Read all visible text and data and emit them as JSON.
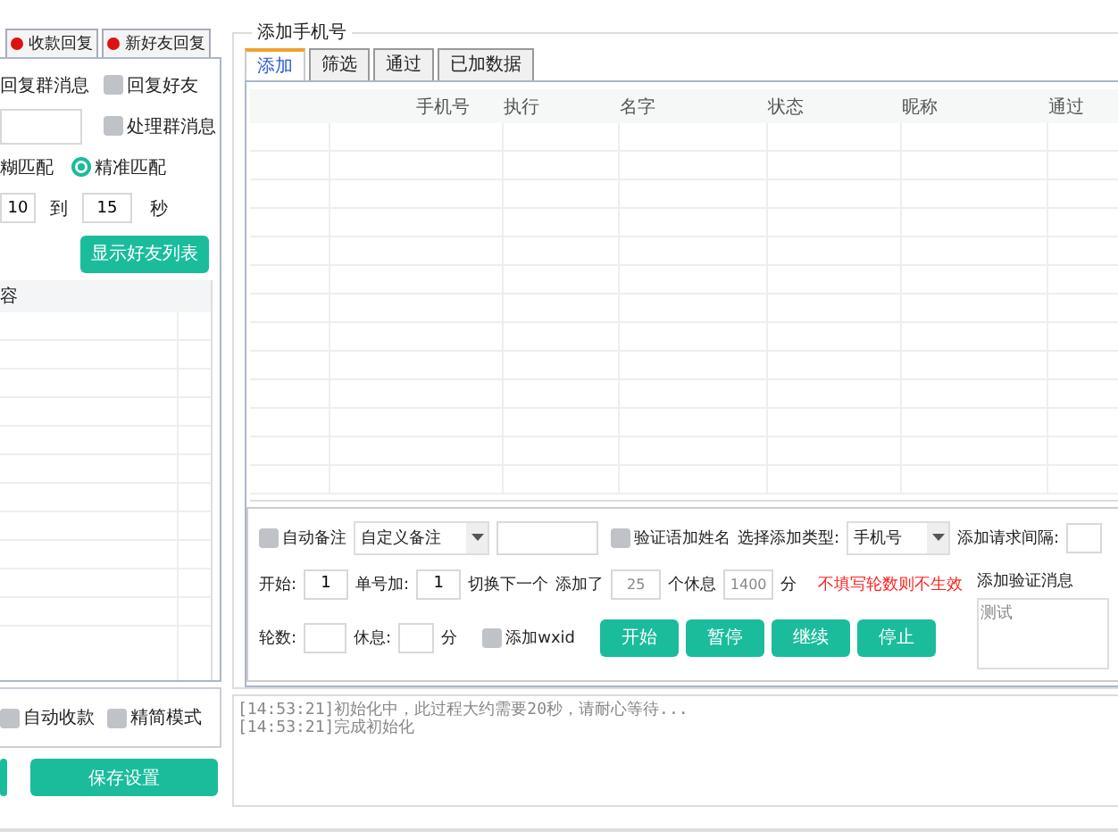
{
  "left_panel": {
    "tabs": [
      {
        "label": "收款回复",
        "color": "#dd1111"
      },
      {
        "label": "新好友回复",
        "color": "#dd1111"
      }
    ],
    "reply_group_label": "回复群消息",
    "reply_friend": {
      "label": "回复好友",
      "checked": false
    },
    "handle_group": {
      "label": "处理群消息",
      "checked": false
    },
    "fuzzy_label": "糊匹配",
    "exact_match": {
      "label": "精准匹配",
      "selected": true
    },
    "interval": {
      "from": "10",
      "to_label": "到",
      "to": "15",
      "unit": "秒"
    },
    "show_friends_button": "显示好友列表",
    "table": {
      "columns": [
        "容"
      ]
    },
    "auto_collect": {
      "label": "自动收款",
      "checked": false
    },
    "simple_mode": {
      "label": "精简模式",
      "checked": false
    },
    "save_button": "保存设置"
  },
  "add_phone": {
    "title": "添加手机号",
    "tabs": [
      {
        "label": "添加",
        "selected": true
      },
      {
        "label": "筛选",
        "selected": false
      },
      {
        "label": "通过",
        "selected": false
      },
      {
        "label": "已加数据",
        "selected": false
      }
    ],
    "table": {
      "columns": [
        "手机号",
        "执行",
        "名字",
        "状态",
        "昵称",
        "通过"
      ]
    },
    "auto_note": {
      "label": "自动备注",
      "checked": false
    },
    "note_select": "自定义备注",
    "verify_name": {
      "label": "验证语加姓名",
      "checked": false
    },
    "type_label": "选择添加类型:",
    "type_select": "手机号",
    "interval_label": "添加请求间隔:",
    "start_label": "开始:",
    "start_value": "1",
    "step_label": "单号加:",
    "step_value": "1",
    "switch_label": "切换下一个",
    "added_label": "添加了",
    "added_value": "25",
    "rest_label": "个休息",
    "rest_value": "1400",
    "rest_unit": "分",
    "warning": "不填写轮数则不生效",
    "verify_label": "添加验证消息",
    "verify_message": "测试",
    "rounds_label": "轮数:",
    "pause_label": "休息:",
    "pause_unit": "分",
    "add_wxid": {
      "label": "添加wxid",
      "checked": false
    },
    "buttons": [
      "开始",
      "暂停",
      "继续",
      "停止"
    ]
  },
  "log": [
    "[14:53:21]初始化中，此过程大约需要20秒，请耐心等待...",
    "[14:53:21]完成初始化"
  ]
}
